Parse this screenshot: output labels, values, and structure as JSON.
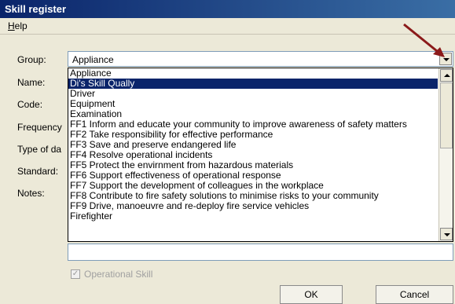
{
  "window": {
    "title": "Skill register"
  },
  "menu": {
    "help_first": "H",
    "help_rest": "elp"
  },
  "labels": {
    "group": "Group:",
    "name": "Name:",
    "code": "Code:",
    "frequency": "Frequency",
    "type": "Type of da",
    "standard": "Standard:",
    "notes": "Notes:"
  },
  "group_combo": {
    "value": "Appliance"
  },
  "dropdown": {
    "items": [
      "Appliance",
      "Di's Skill Qually",
      "Driver",
      "Equipment",
      "Examination",
      "FF1 Inform and educate your community to improve awareness of safety matters",
      "FF2 Take responsibility for effective performance",
      "FF3 Save and preserve endangered life",
      "FF4 Resolve operational incidents",
      "FF5 Protect the envirnment from hazardous materials",
      "FF6 Support effectiveness of operational response",
      "FF7 Support the development of colleagues in the workplace",
      "FF8 Contribute to fire safety solutions to minimise risks to your community",
      "FF9 Drive, manoeuvre and re-deploy fire service vehicles",
      "Firefighter"
    ],
    "selected_index": 1
  },
  "operational_skill": {
    "label": "Operational Skill",
    "checked": true,
    "enabled": false
  },
  "buttons": {
    "ok": "OK",
    "cancel": "Cancel"
  },
  "colors": {
    "selection": "#0a246a",
    "annotation_arrow": "#8b1a1a"
  },
  "icons": {
    "combo_button": "chevron-down-icon",
    "scroll_up": "chevron-up-icon",
    "scroll_down": "chevron-down-icon",
    "annotation": "red-arrow-icon"
  }
}
